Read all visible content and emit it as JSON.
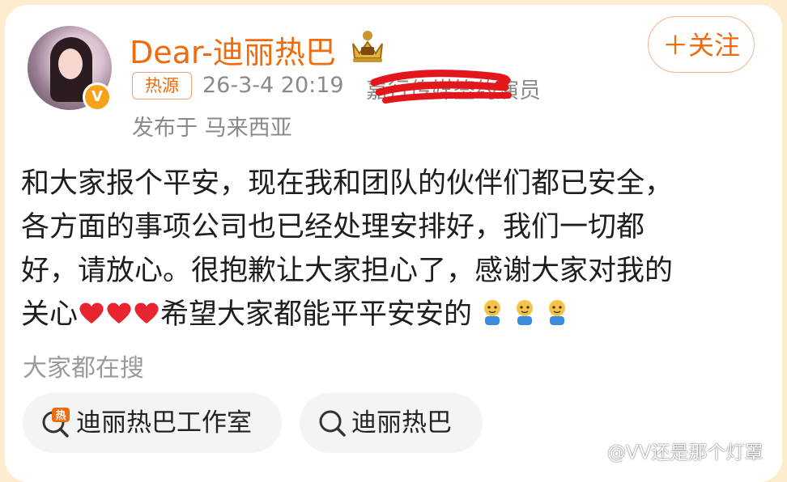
{
  "post": {
    "author": {
      "name": "Dear-迪丽热巴",
      "verified": true
    },
    "follow_label": "＋关注",
    "badge": "热源",
    "timestamp": "26-3-4 20:19",
    "source_text": "嘉行传媒签约演员",
    "location": "发布于 马来西亚",
    "content_lines": [
      "和大家报个平安，现在我和团队的伙伴们都已安全，",
      "各方面的事项公司也已经处理安排好，我们一切都",
      "好，请放心。很抱歉让大家担心了，感谢大家对我的",
      "关心",
      "希望大家都能平平安安的"
    ]
  },
  "hot_search": {
    "heading": "大家都在搜",
    "items": [
      {
        "label": "迪丽热巴工作室",
        "icon": "hot-search-icon"
      },
      {
        "label": "迪丽热巴",
        "icon": "search-icon"
      }
    ]
  },
  "watermark": "@VV还是那个灯罩",
  "colors": {
    "accent": "#f06a0e",
    "meta_text": "#8a8a8a",
    "chip_bg": "#f4f4f4"
  }
}
